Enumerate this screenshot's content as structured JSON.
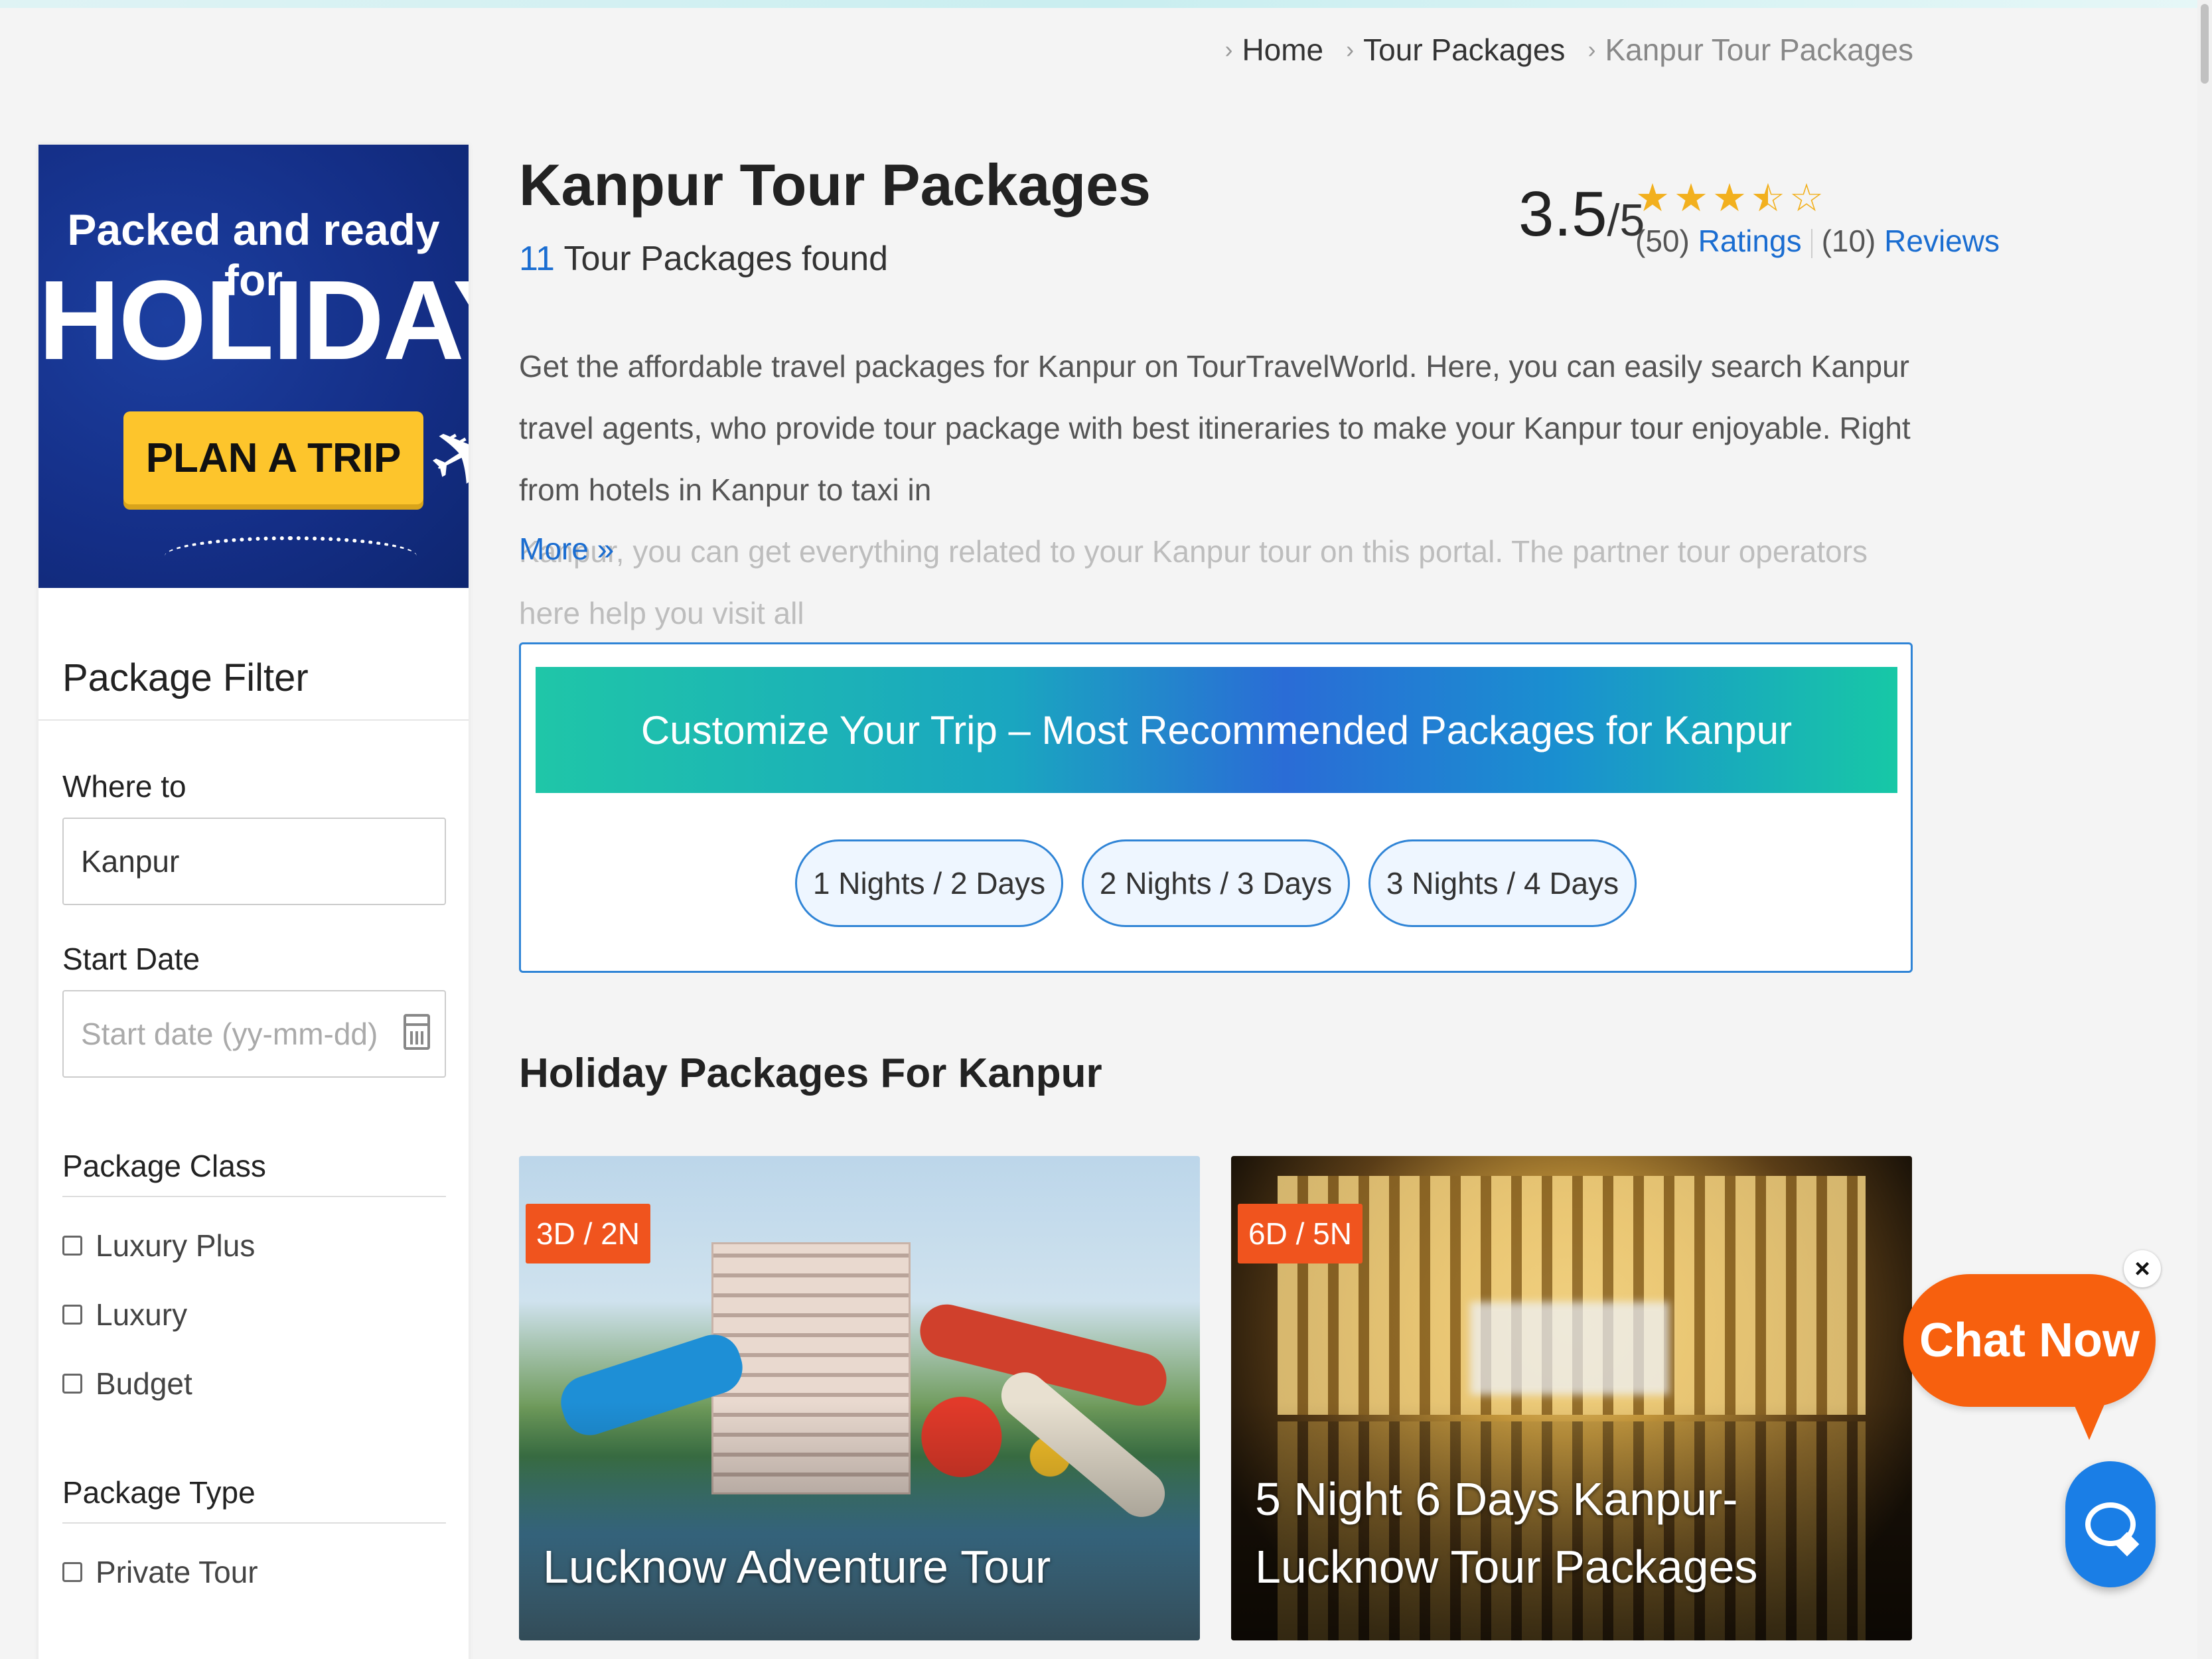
{
  "breadcrumb": {
    "home": "Home",
    "tour_packages": "Tour Packages",
    "current": "Kanpur Tour Packages"
  },
  "banner": {
    "line1": "Packed and ready for",
    "line2": "HOLIDAY?",
    "cta": "PLAN A TRIP"
  },
  "filter": {
    "title": "Package Filter",
    "where_label": "Where to",
    "where_value": "Kanpur",
    "start_label": "Start Date",
    "start_placeholder": "Start date (yy-mm-dd)",
    "class_title": "Package Class",
    "classes": [
      "Luxury Plus",
      "Luxury",
      "Budget"
    ],
    "type_title": "Package Type",
    "types": [
      "Private Tour"
    ]
  },
  "main": {
    "title": "Kanpur Tour Packages",
    "found_count": "11",
    "found_text": "Tour Packages found",
    "rating": {
      "score": "3.5",
      "out_of": "/5",
      "stars_filled": 3,
      "stars_half": 1,
      "ratings_count": "(50)",
      "ratings_link": "Ratings",
      "reviews_count": "(10)",
      "reviews_link": "Reviews"
    },
    "description_1": "Get the affordable travel packages for Kanpur on TourTravelWorld. Here, you can easily search Kanpur travel agents, who provide tour package with best itineraries to make your Kanpur tour enjoyable. Right from hotels in Kanpur to taxi in",
    "description_2": "Kanpur, you can get everything related to your Kanpur tour on this portal. The partner tour operators here help you visit all",
    "more": "More »",
    "customize": {
      "heading": "Customize Your Trip – Most Recommended Packages for Kanpur",
      "options": [
        "1 Nights / 2 Days",
        "2 Nights / 3 Days",
        "3 Nights / 4 Days"
      ]
    },
    "section_title": "Holiday Packages For Kanpur",
    "cards": [
      {
        "badge": "3D / 2N",
        "title": "Lucknow Adventure Tour"
      },
      {
        "badge": "6D / 5N",
        "title": "5 Night 6 Days Kanpur- Lucknow Tour Packages"
      }
    ]
  },
  "chat": {
    "label": "Chat Now",
    "close": "×"
  },
  "colors": {
    "accent_blue": "#1a6dd1",
    "chat_orange": "#f7600e",
    "badge_orange": "#f0541e",
    "star_gold": "#f2b01e",
    "cta_yellow": "#fdc52c"
  }
}
